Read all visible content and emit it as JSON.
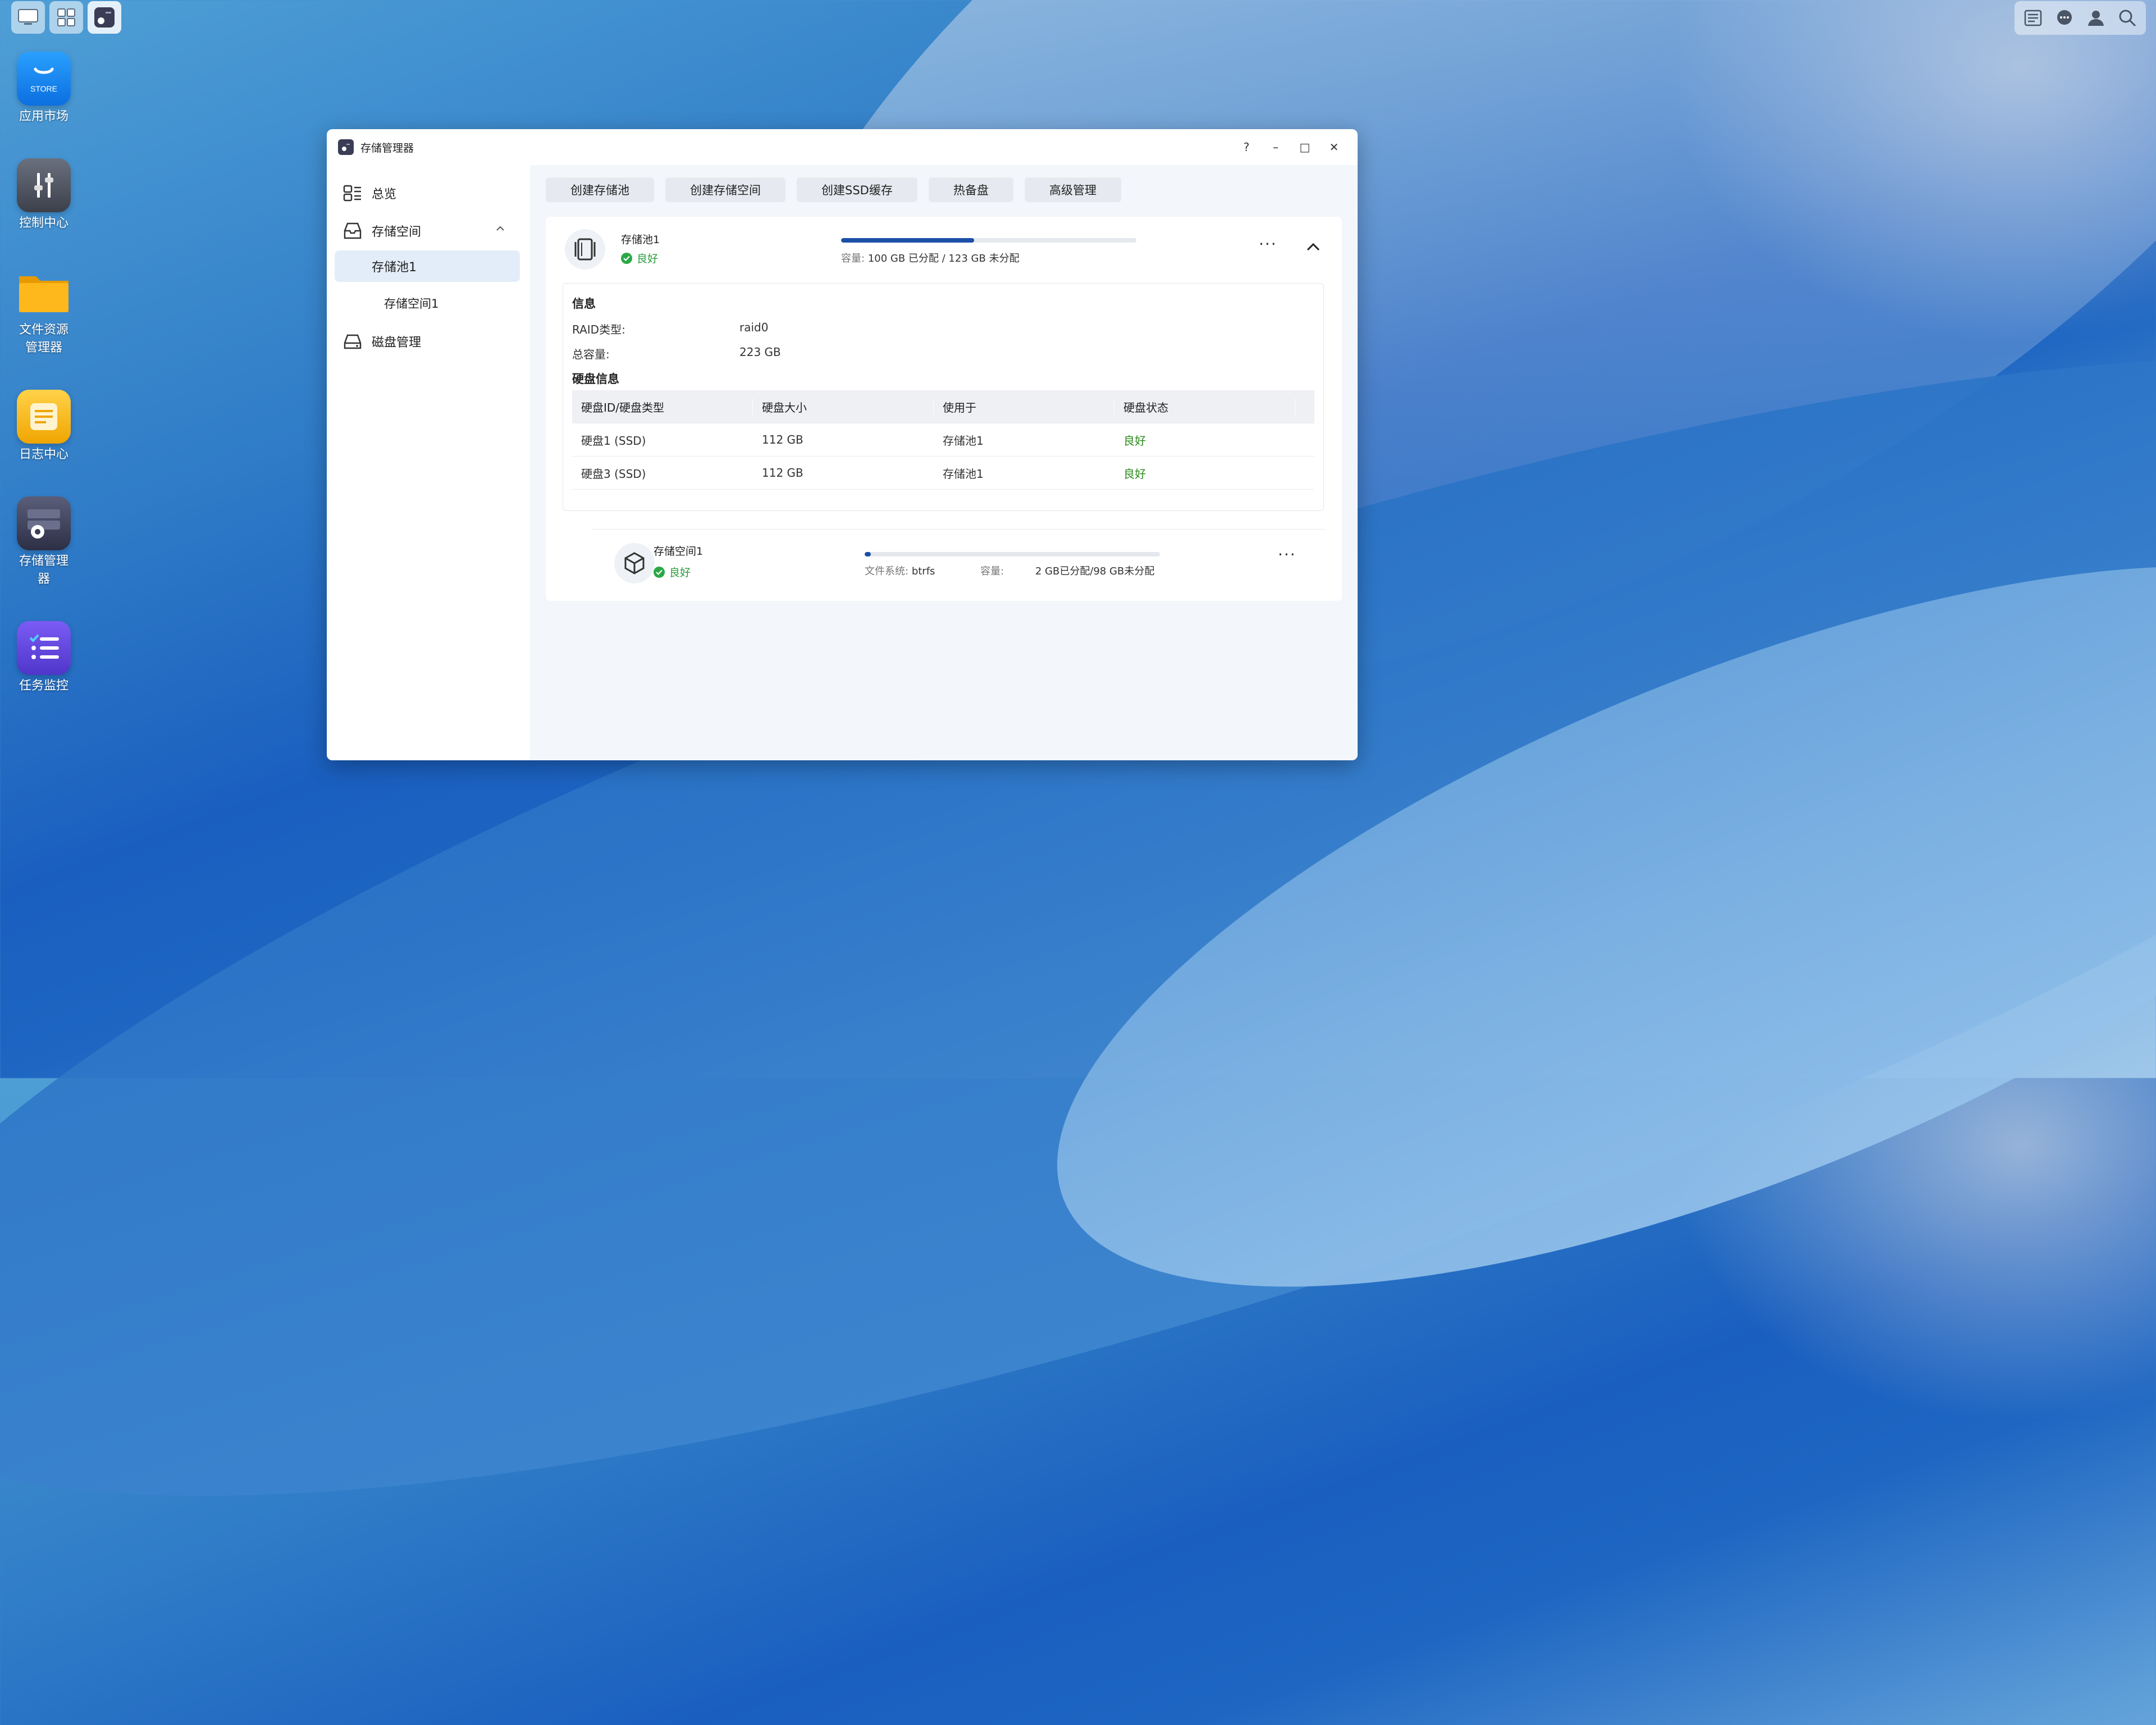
{
  "desktop": {
    "icons": [
      {
        "name": "app-store",
        "label": "应用市场",
        "badge": "STORE",
        "color": "#1a8cf0"
      },
      {
        "name": "control-center",
        "label": "控制中心",
        "color": "#4a4f5c"
      },
      {
        "name": "file-manager",
        "label": "文件资源\n管理器",
        "color": "#f7a700"
      },
      {
        "name": "log-center",
        "label": "日志中心",
        "color": "#f6b21c"
      },
      {
        "name": "storage-manager",
        "label": "存储管理\n器",
        "color": "#3b3f5a"
      },
      {
        "name": "task-monitor",
        "label": "任务监控",
        "color": "#6a4de0"
      }
    ]
  },
  "window": {
    "title": "存储管理器",
    "controls": {
      "help": "?",
      "minimize": "–",
      "maximize": "□",
      "close": "✕"
    }
  },
  "sidebar": {
    "items": [
      {
        "label": "总览"
      },
      {
        "label": "存储空间"
      },
      {
        "label": "存储池1"
      },
      {
        "label": "存储空间1"
      },
      {
        "label": "磁盘管理"
      }
    ]
  },
  "toolbar": {
    "buttons": [
      "创建存储池",
      "创建存储空间",
      "创建SSD缓存",
      "热备盘",
      "高级管理"
    ]
  },
  "pool": {
    "name": "存储池1",
    "status": "良好",
    "usage_fraction": 0.45,
    "capacity_label": "容量:",
    "capacity_value": "100 GB 已分配 / 123 GB 未分配",
    "info_title": "信息",
    "raid_label": "RAID类型:",
    "raid_value": "raid0",
    "total_label": "总容量:",
    "total_value": "223 GB",
    "disk_info_title": "硬盘信息",
    "table": {
      "headers": [
        "硬盘ID/硬盘类型",
        "硬盘大小",
        "使用于",
        "硬盘状态"
      ],
      "rows": [
        [
          "硬盘1 (SSD)",
          "112 GB",
          "存储池1",
          "良好"
        ],
        [
          "硬盘3 (SSD)",
          "112 GB",
          "存储池1",
          "良好"
        ]
      ]
    }
  },
  "volume": {
    "name": "存储空间1",
    "status": "良好",
    "usage_fraction": 0.02,
    "fs_label": "文件系统:",
    "fs_value": "btrfs",
    "capacity_label": "容量:",
    "capacity_value": "2 GB已分配/98 GB未分配"
  },
  "colors": {
    "accent": "#1c4fa8",
    "status_good": "#2aa847"
  }
}
